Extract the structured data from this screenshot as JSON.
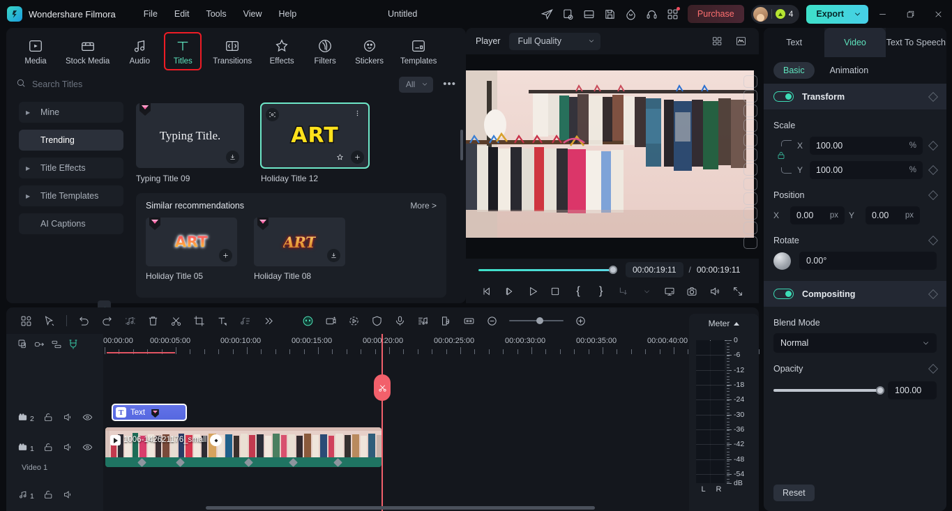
{
  "titlebar": {
    "brand": "Wondershare Filmora",
    "menus": [
      "File",
      "Edit",
      "Tools",
      "View",
      "Help"
    ],
    "document_title": "Untitled",
    "icons": [
      "send-icon",
      "export-list-icon",
      "layout-icon",
      "save-icon",
      "cloud-icon",
      "headset-icon",
      "apps-grid-icon"
    ],
    "purchase_label": "Purchase",
    "credits": "4",
    "export_label": "Export",
    "window_buttons": [
      "minimize-icon",
      "restore-icon",
      "close-icon"
    ],
    "accent_export": "#3ee0c8",
    "accent_purchase": "#ff7070"
  },
  "categories": [
    {
      "label": "Media",
      "icon": "media-icon"
    },
    {
      "label": "Stock Media",
      "icon": "stock-media-icon"
    },
    {
      "label": "Audio",
      "icon": "audio-icon"
    },
    {
      "label": "Titles",
      "icon": "titles-icon"
    },
    {
      "label": "Transitions",
      "icon": "transitions-icon"
    },
    {
      "label": "Effects",
      "icon": "effects-icon"
    },
    {
      "label": "Filters",
      "icon": "filters-icon"
    },
    {
      "label": "Stickers",
      "icon": "stickers-icon"
    },
    {
      "label": "Templates",
      "icon": "templates-icon"
    }
  ],
  "search": {
    "placeholder": "Search Titles",
    "value": "",
    "filter_label": "All",
    "more_label": "•••"
  },
  "sidebar": {
    "items": [
      {
        "label": "Mine",
        "expandable": true
      },
      {
        "label": "Trending",
        "expandable": false
      },
      {
        "label": "Title Effects",
        "expandable": true
      },
      {
        "label": "Title Templates",
        "expandable": true
      },
      {
        "label": "AI Captions",
        "expandable": false
      }
    ],
    "active_index": 1
  },
  "results": {
    "tiles": [
      {
        "name": "Typing Title 09",
        "preview_text": "Typing Title.",
        "style": "serif",
        "premium": true,
        "action": "download-icon"
      },
      {
        "name": "Holiday Title 12",
        "preview_text": "ART",
        "style": "yellow-block",
        "premium": false,
        "selected": true,
        "actions": [
          "preview-icon",
          "more-icon",
          "favorite-icon",
          "add-icon"
        ]
      }
    ],
    "similar": {
      "title": "Similar recommendations",
      "more_label": "More >",
      "tiles": [
        {
          "name": "Holiday Title 05",
          "preview_text": "ART",
          "style": "gradient-bubble",
          "premium": true,
          "action": "add-icon"
        },
        {
          "name": "Holiday Title 08",
          "preview_text": "ART",
          "style": "gold-script",
          "premium": true,
          "action": "download-icon"
        }
      ]
    }
  },
  "player": {
    "label": "Player",
    "quality": "Full Quality",
    "quality_options": [
      "Full Quality"
    ],
    "header_icons": [
      "split-view-icon",
      "waveform-icon"
    ],
    "current_time": "00:00:19:11",
    "separator": "/",
    "total_time": "00:00:19:11",
    "progress_percent": 100,
    "controls": [
      {
        "name": "prev-frame-button",
        "icon": "prev-frame-icon"
      },
      {
        "name": "next-frame-button",
        "icon": "next-frame-icon"
      },
      {
        "name": "play-button",
        "icon": "play-icon"
      },
      {
        "name": "stop-button",
        "icon": "stop-icon"
      },
      {
        "name": "mark-in-button",
        "icon": "brace-open-icon",
        "glyph": "{"
      },
      {
        "name": "mark-out-button",
        "icon": "brace-close-icon",
        "glyph": "}"
      },
      {
        "name": "keyframe-button",
        "icon": "keyframe-icon"
      },
      {
        "name": "keyframe-dropdown",
        "icon": "chevron-down-icon"
      },
      {
        "name": "display-button",
        "icon": "monitor-icon"
      },
      {
        "name": "snapshot-button",
        "icon": "camera-icon"
      },
      {
        "name": "volume-button",
        "icon": "speaker-icon"
      },
      {
        "name": "fullscreen-button",
        "icon": "fullscreen-icon"
      }
    ]
  },
  "properties": {
    "tabs": [
      {
        "label": "Text",
        "active": false
      },
      {
        "label": "Video",
        "active": true
      },
      {
        "label": "Text To Speech",
        "active": false
      }
    ],
    "subtabs": [
      {
        "label": "Basic",
        "active": true
      },
      {
        "label": "Animation",
        "active": false
      }
    ],
    "transform": {
      "section_label": "Transform",
      "enabled": true,
      "scale_label": "Scale",
      "scale_x": "100.00",
      "scale_y": "100.00",
      "scale_unit": "%",
      "axis_x": "X",
      "axis_y": "Y",
      "position_label": "Position",
      "pos_x": "0.00",
      "pos_y": "0.00",
      "pos_unit": "px",
      "rotate_label": "Rotate",
      "rotate_value": "0.00°"
    },
    "compositing": {
      "section_label": "Compositing",
      "enabled": true,
      "blend_label": "Blend Mode",
      "blend_value": "Normal",
      "blend_options": [
        "Normal"
      ],
      "opacity_label": "Opacity",
      "opacity_value": "100.00",
      "opacity_percent": 100
    },
    "reset_label": "Reset",
    "accent": "#3ddcb6"
  },
  "timeline": {
    "toolbar_left": [
      {
        "name": "layout-grid-button",
        "icon": "grid-icon"
      },
      {
        "name": "select-tool-button",
        "icon": "cursor-icon"
      },
      {
        "name": "undo-button",
        "icon": "undo-icon"
      },
      {
        "name": "redo-button",
        "icon": "redo-icon"
      },
      {
        "name": "audio-detach-button",
        "icon": "music-split-icon"
      },
      {
        "name": "delete-button",
        "icon": "trash-icon"
      },
      {
        "name": "split-button",
        "icon": "scissors-icon"
      },
      {
        "name": "crop-button",
        "icon": "crop-icon"
      },
      {
        "name": "text-button",
        "icon": "text-icon"
      },
      {
        "name": "speed-button",
        "icon": "speed-icon"
      },
      {
        "name": "more-tools-button",
        "icon": "chevron-double-right-icon"
      }
    ],
    "toolbar_right": [
      {
        "name": "ai-mask-button",
        "icon": "ai-face-icon"
      },
      {
        "name": "ai-tools-button",
        "icon": "ai-magic-icon"
      },
      {
        "name": "motion-tracking-button",
        "icon": "motion-track-icon"
      },
      {
        "name": "mask-button",
        "icon": "shield-icon"
      },
      {
        "name": "voiceover-button",
        "icon": "mic-icon"
      },
      {
        "name": "audio-mixer-button",
        "icon": "mixer-icon"
      },
      {
        "name": "green-screen-button",
        "icon": "green-screen-icon"
      },
      {
        "name": "fit-timeline-button",
        "icon": "fit-width-icon"
      },
      {
        "name": "zoom-out-button",
        "icon": "minus-circle-icon"
      },
      {
        "name": "zoom-in-button",
        "icon": "plus-circle-icon"
      }
    ],
    "head_icons": [
      {
        "name": "add-track-button",
        "icon": "add-track-icon"
      },
      {
        "name": "link-button",
        "icon": "link-icon"
      },
      {
        "name": "auto-layout-button",
        "icon": "auto-layout-icon"
      },
      {
        "name": "magnet-button",
        "icon": "magnet-icon",
        "active": true
      }
    ],
    "ruler_labels": [
      "00:00:00",
      "00:00:05:00",
      "00:00:10:00",
      "00:00:15:00",
      "00:00:20:00",
      "00:00:25:00",
      "00:00:30:00",
      "00:00:35:00",
      "00:00:40:00"
    ],
    "tracks": [
      {
        "num": "2",
        "type": "video",
        "name": ""
      },
      {
        "num": "1",
        "type": "video",
        "name": "Video 1"
      },
      {
        "num": "1",
        "type": "audio",
        "name": ""
      }
    ],
    "text_clip": {
      "label": "Text",
      "badge": "T",
      "premium": true
    },
    "video_clip": {
      "label": "1006-142621176_small"
    },
    "playhead_time": "00:00:19:11"
  },
  "meter": {
    "title": "Meter",
    "scale": [
      "0",
      "-6",
      "-12",
      "-18",
      "-24",
      "-30",
      "-36",
      "-42",
      "-48",
      "-54"
    ],
    "unit": "dB",
    "channels": [
      "L",
      "R"
    ]
  }
}
